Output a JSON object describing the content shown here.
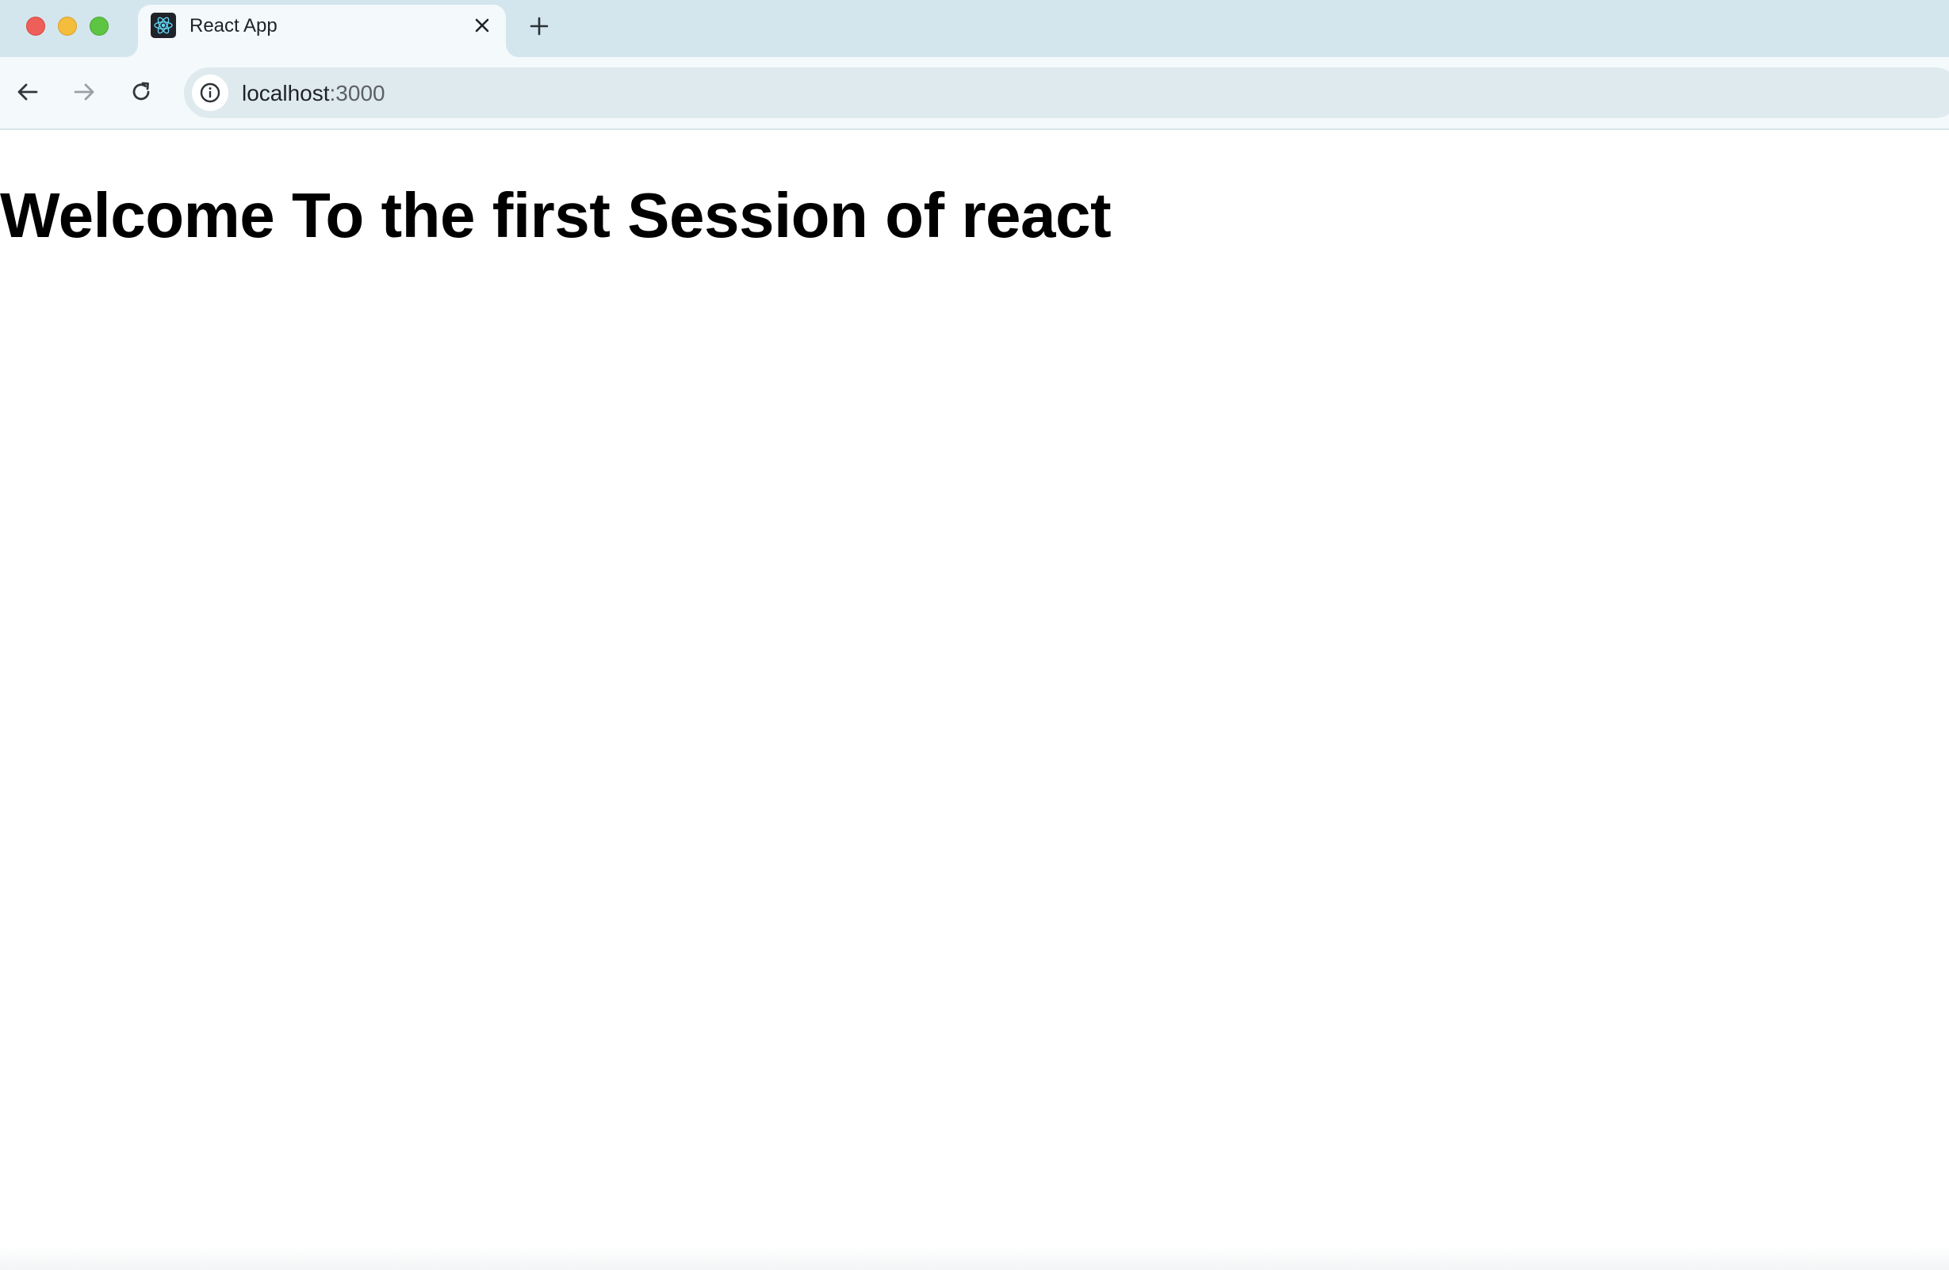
{
  "window": {
    "controls": {
      "close_color": "#ee5f59",
      "minimize_color": "#f4bd3b",
      "zoom_color": "#5dc542"
    }
  },
  "tabs": [
    {
      "title": "React App",
      "favicon": "react-logo-icon",
      "active": true
    }
  ],
  "toolbar": {
    "back_icon": "arrow-left-icon",
    "forward_icon": "arrow-right-icon",
    "reload_icon": "reload-icon",
    "site_info_icon": "info-icon",
    "url_host": "localhost",
    "url_port": ":3000"
  },
  "page": {
    "heading": "Welcome To the first Session of react"
  },
  "colors": {
    "tabstrip_bg": "#d3e6ed",
    "toolbar_bg": "#f4f9fb",
    "omnibox_bg": "#dfeaef",
    "react_brand": "#61dafb"
  }
}
